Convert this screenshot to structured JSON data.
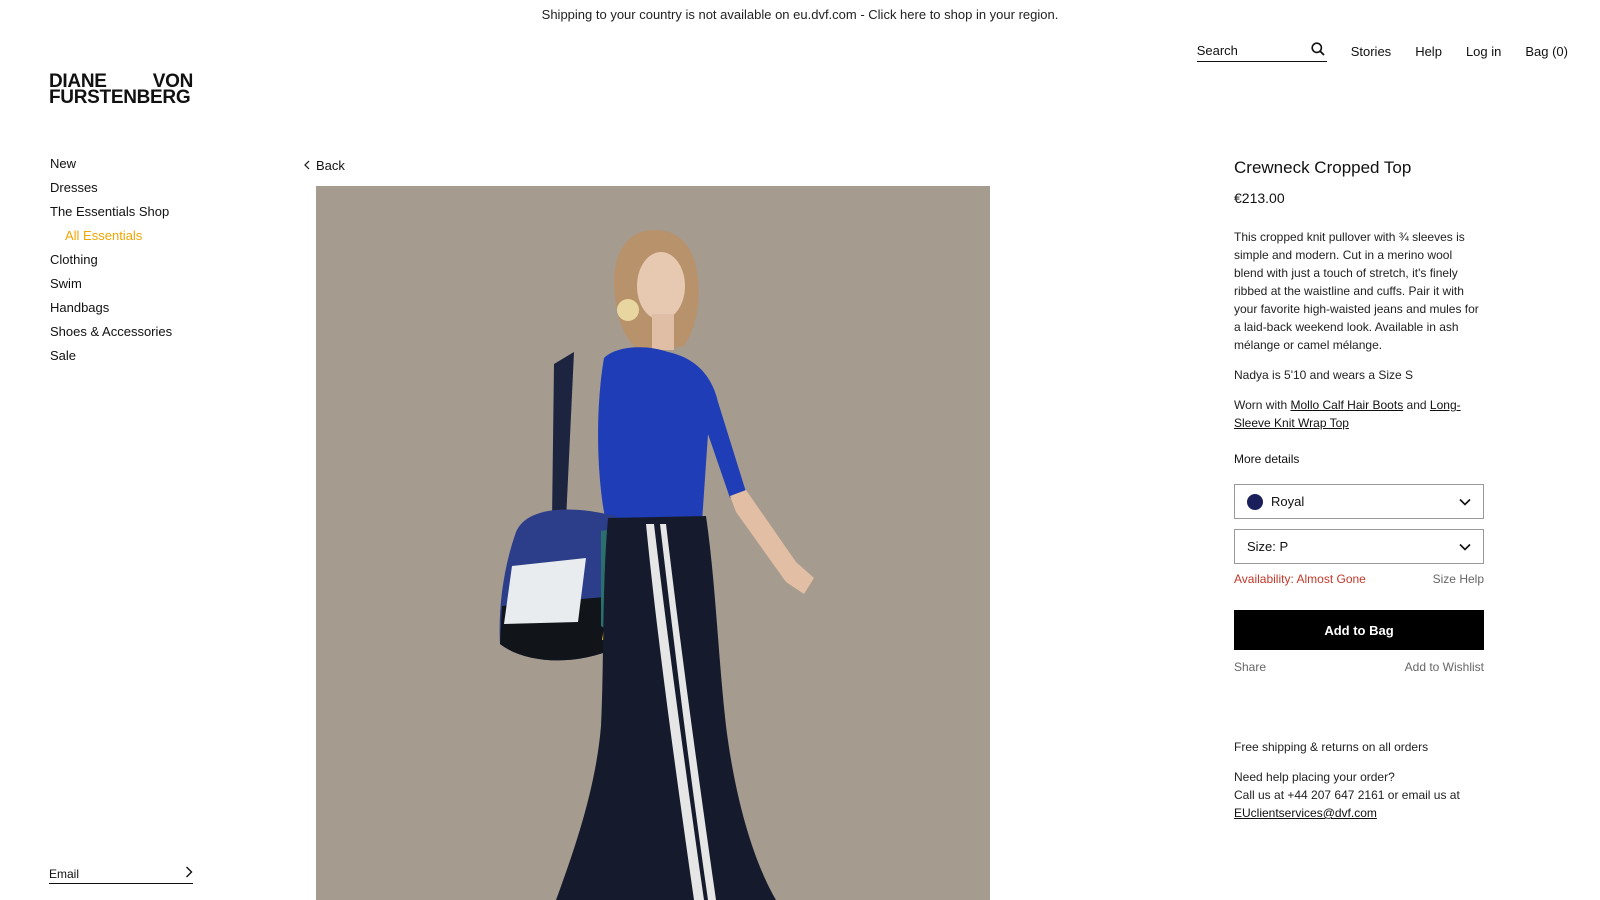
{
  "notice": "Shipping to your country is not available on eu.dvf.com - Click here to shop in your region.",
  "header": {
    "search_placeholder": "Search",
    "links": [
      "Stories",
      "Help",
      "Log in",
      "Bag (0)"
    ]
  },
  "logo": {
    "line1a": "DIANE",
    "line1b": "VON",
    "line2": "FURSTENBERG"
  },
  "nav": {
    "items": [
      "New",
      "Dresses",
      "The Essentials Shop",
      "All Essentials",
      "Clothing",
      "Swim",
      "Handbags",
      "Shoes & Accessories",
      "Sale"
    ]
  },
  "footer": {
    "email_placeholder": "Email"
  },
  "back_label": "Back",
  "product": {
    "title": "Crewneck Cropped Top",
    "price": "€213.00",
    "description": "This cropped knit pullover with ¾ sleeves is simple and modern. Cut in a merino wool blend with just a touch of stretch, it's finely ribbed at the waistline and cuffs. Pair it with your favorite high-waisted jeans and mules for a laid-back weekend look. Available in ash mélange or camel mélange.",
    "fit_note": "Nadya is 5'10 and wears a Size S",
    "worn_prefix": "Worn with",
    "worn_link1": "Mollo Calf Hair Boots",
    "worn_and": "and",
    "worn_link2": "Long-Sleeve Knit Wrap Top",
    "more_details": "More details",
    "color_selected": "Royal",
    "size_selected": "Size: P",
    "availability": "Availability: Almost Gone",
    "size_help": "Size Help",
    "add_to_bag": "Add to Bag",
    "share": "Share",
    "wishlist": "Add to Wishlist"
  },
  "info": {
    "shipping": "Free shipping & returns on all orders",
    "help_line1": "Need help placing your order?",
    "help_line2": "Call us at +44 207 647 2161 or email us at",
    "email": "EUclientservices@dvf.com"
  },
  "colors": {
    "accent": "#f0a500",
    "alert": "#c0392b",
    "swatch_royal": "#1a1f5c"
  }
}
